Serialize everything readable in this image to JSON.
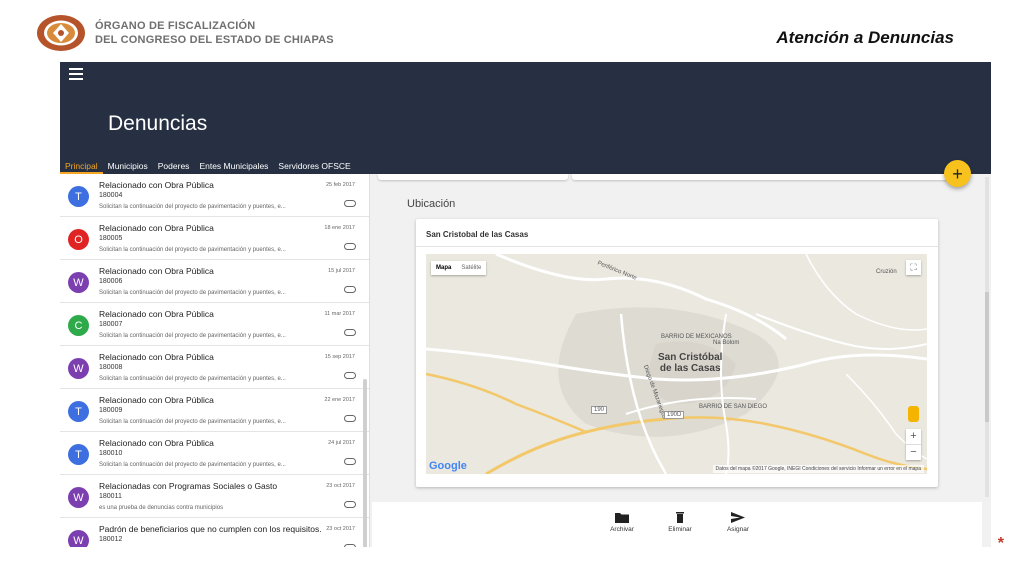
{
  "header": {
    "org_line1": "ÓRGANO DE FISCALIZACIÓN",
    "org_line2": "DEL CONGRESO DEL ESTADO DE CHIAPAS",
    "slide_title": "Atención a Denuncias",
    "footnote_mark": "*"
  },
  "app": {
    "title": "Denuncias",
    "tabs": [
      {
        "label": "Principal",
        "active": true
      },
      {
        "label": "Municipios",
        "active": false
      },
      {
        "label": "Poderes",
        "active": false
      },
      {
        "label": "Entes Municipales",
        "active": false
      },
      {
        "label": "Servidores OFSCE",
        "active": false
      }
    ],
    "fab_label": "+",
    "accent_color": "#f5a623"
  },
  "list": {
    "items": [
      {
        "avatar": "T",
        "color": "#3d6fe0",
        "title": "Relacionado con Obra Pública",
        "code": "180004",
        "date": "25 feb 2017",
        "desc": "Solicitan la continuación del proyecto de pavimentación y puentes, e..."
      },
      {
        "avatar": "O",
        "color": "#e02424",
        "title": "Relacionado con Obra Pública",
        "code": "180005",
        "date": "18 ene 2017",
        "desc": "Solicitan la continuación del proyecto de pavimentación y puentes, e..."
      },
      {
        "avatar": "W",
        "color": "#7b3fb0",
        "title": "Relacionado con Obra Pública",
        "code": "180006",
        "date": "15 jul 2017",
        "desc": "Solicitan la continuación del proyecto de pavimentación y puentes, e..."
      },
      {
        "avatar": "C",
        "color": "#2eaa4a",
        "title": "Relacionado con Obra Pública",
        "code": "180007",
        "date": "11 mar 2017",
        "desc": "Solicitan la continuación del proyecto de pavimentación y puentes, e..."
      },
      {
        "avatar": "W",
        "color": "#7b3fb0",
        "title": "Relacionado con Obra Pública",
        "code": "180008",
        "date": "15 sep 2017",
        "desc": "Solicitan la continuación del proyecto de pavimentación y puentes, e..."
      },
      {
        "avatar": "T",
        "color": "#3d6fe0",
        "title": "Relacionado con Obra Pública",
        "code": "180009",
        "date": "22 ene 2017",
        "desc": "Solicitan la continuación del proyecto de pavimentación y puentes, e..."
      },
      {
        "avatar": "T",
        "color": "#3d6fe0",
        "title": "Relacionado con Obra Pública",
        "code": "180010",
        "date": "24 jul 2017",
        "desc": "Solicitan la continuación del proyecto de pavimentación y puentes, e..."
      },
      {
        "avatar": "W",
        "color": "#7b3fb0",
        "title": "Relacionadas con Programas Sociales o Gasto",
        "code": "180011",
        "date": "23 oct 2017",
        "desc": "es una prueba de denuncias contra municipios"
      },
      {
        "avatar": "W",
        "color": "#7b3fb0",
        "title": "Padrón de beneficiarios que no cumplen con los requisitos.",
        "code": "180012",
        "date": "23 oct 2017",
        "desc": ""
      }
    ]
  },
  "detail": {
    "section_title": "Ubicación",
    "map_card_title": "San Cristobal de las Casas",
    "map": {
      "type_selected": "Mapa",
      "type_other": "Satélite",
      "fullscreen_icon": "⛶",
      "zoom_in": "+",
      "zoom_out": "−",
      "google_logo": "Google",
      "attribution": "Datos del mapa ©2017 Google, INEGI    Condiciones del servicio    Informar un error en el mapa",
      "labels": {
        "city": "San Cristóbal\nde las Casas",
        "barrio_mexicanos": "BARRIO DE\nMEXICANOS",
        "barrio_san_diego": "BARRIO DE\nSAN DIEGO",
        "na_bolom": "Na Bolom",
        "cruzion": "Cruzión",
        "periferico_norte": "Periférico Norte",
        "diego_de_mazariegos": "Diego de Mazariegos",
        "mexico_190": "190",
        "mexico_190d": "190D"
      }
    }
  },
  "actions": [
    {
      "label": "Archivar",
      "icon": "folder-icon"
    },
    {
      "label": "Eliminar",
      "icon": "trash-icon"
    },
    {
      "label": "Asignar",
      "icon": "send-icon"
    }
  ]
}
